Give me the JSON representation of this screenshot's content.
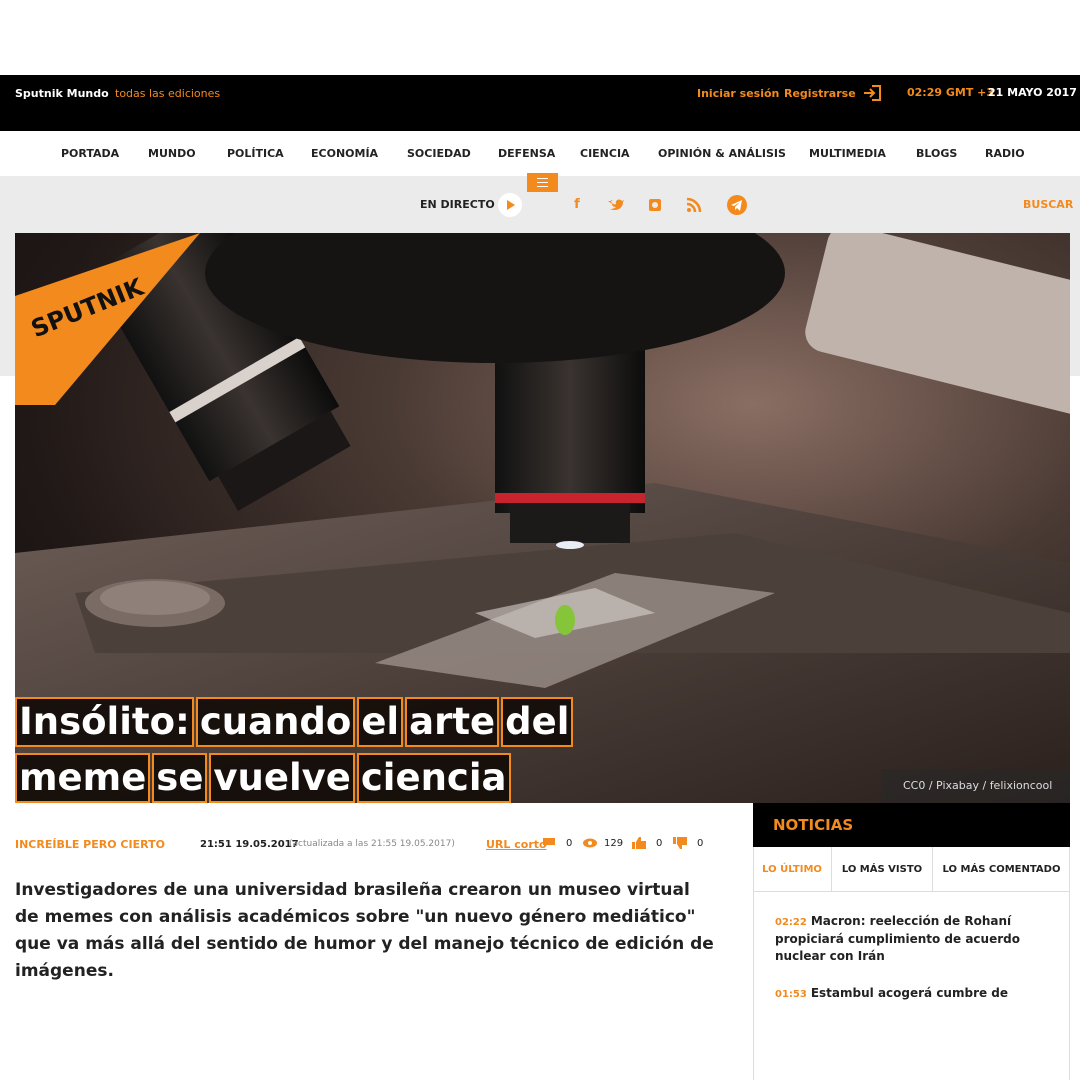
{
  "topbar": {
    "brand": "Sputnik Mundo",
    "editions": "todas las ediciones",
    "login": "Iniciar sesión",
    "register": "Registrarse",
    "time": "02:29 GMT +3",
    "date": "21 MAYO 2017"
  },
  "nav": [
    "PORTADA",
    "MUNDO",
    "POLÍTICA",
    "ECONOMÍA",
    "SOCIEDAD",
    "DEFENSA",
    "CIENCIA",
    "OPINIÓN & ANÁLISIS",
    "MULTIMEDIA",
    "BLOGS",
    "RADIO"
  ],
  "toolbar": {
    "live": "EN DIRECTO",
    "search": "BUSCAR",
    "social_icons": [
      "facebook-icon",
      "twitter-icon",
      "instagram-icon",
      "rss-icon",
      "telegram-icon"
    ]
  },
  "logo": {
    "text": "SPUTNIK"
  },
  "hero": {
    "headline_line1": [
      "Insólito:",
      "cuando",
      "el",
      "arte",
      "del"
    ],
    "headline_line2": [
      "meme",
      "se",
      "vuelve",
      "ciencia"
    ],
    "credit": "CC0 / Pixabay / felixioncool"
  },
  "meta": {
    "rubric": "INCREÍBLE PERO CIERTO",
    "published": "21:51 19.05.2017",
    "updated": "(actualizada a las 21:55 19.05.2017)",
    "short_url": "URL corto",
    "comments": "0",
    "views": "129",
    "likes": "0",
    "dislikes": "0"
  },
  "lead": "Investigadores de una universidad brasileña crearon un museo virtual de memes con análisis académicos sobre \"un nuevo género mediático\" que va más allá del sentido de humor y del manejo técnico de edición de imágenes.",
  "sidebar": {
    "title": "NOTICIAS",
    "tabs": [
      "LO ÚLTIMO",
      "LO MÁS VISTO",
      "LO MÁS COMENTADO"
    ],
    "items": [
      {
        "time": "02:22",
        "title": "Macron: reelección de Rohaní propiciará cumplimiento de acuerdo nuclear con Irán"
      },
      {
        "time": "01:53",
        "title": "Estambul acogerá cumbre de"
      }
    ]
  },
  "colors": {
    "accent": "#f28a1e",
    "dark": "#000000",
    "band": "#ebebeb"
  }
}
